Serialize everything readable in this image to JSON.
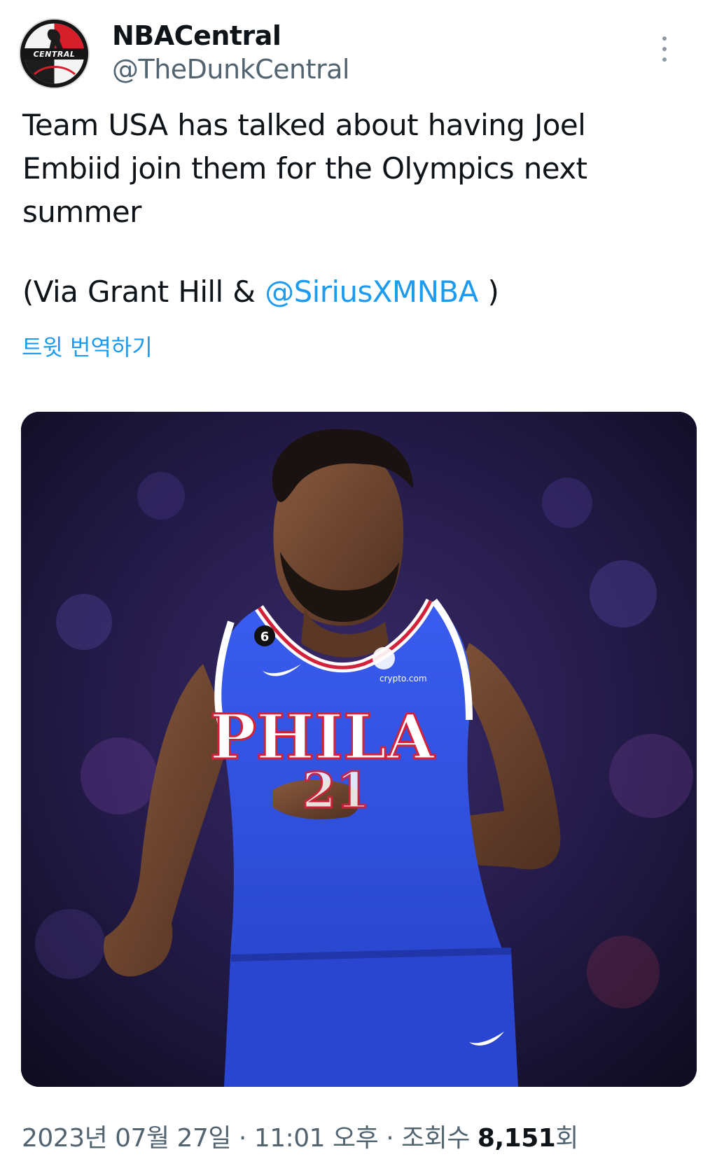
{
  "author": {
    "display_name": "NBACentral",
    "handle": "@TheDunkCentral",
    "avatar_text": "CENTRAL",
    "avatar_icon": "basketball-player-logo"
  },
  "menu": {
    "icon": "more-vertical-icon"
  },
  "tweet": {
    "text_main": "Team USA has talked about having Joel Embiid join them for the Olympics next summer",
    "via_prefix": "(Via Grant Hill & ",
    "via_mention": "@SiriusXMNBA",
    "via_suffix": " )",
    "translate_label": "트윗 번역하기"
  },
  "media": {
    "jersey_text": "PHILA",
    "jersey_number": "21",
    "sponsor_text": "crypto.com",
    "patch_number": "6"
  },
  "meta": {
    "date": "2023년 07월 27일",
    "sep1": " · ",
    "time": "11:01 오후",
    "sep2": " · ",
    "views_label": "조회수 ",
    "views_count": "8,151",
    "views_suffix": "회"
  },
  "colors": {
    "link": "#1d9bf0",
    "text": "#0f1419",
    "secondary": "#536471",
    "jersey_blue": "#2e4fd6",
    "jersey_red": "#d3213a"
  }
}
